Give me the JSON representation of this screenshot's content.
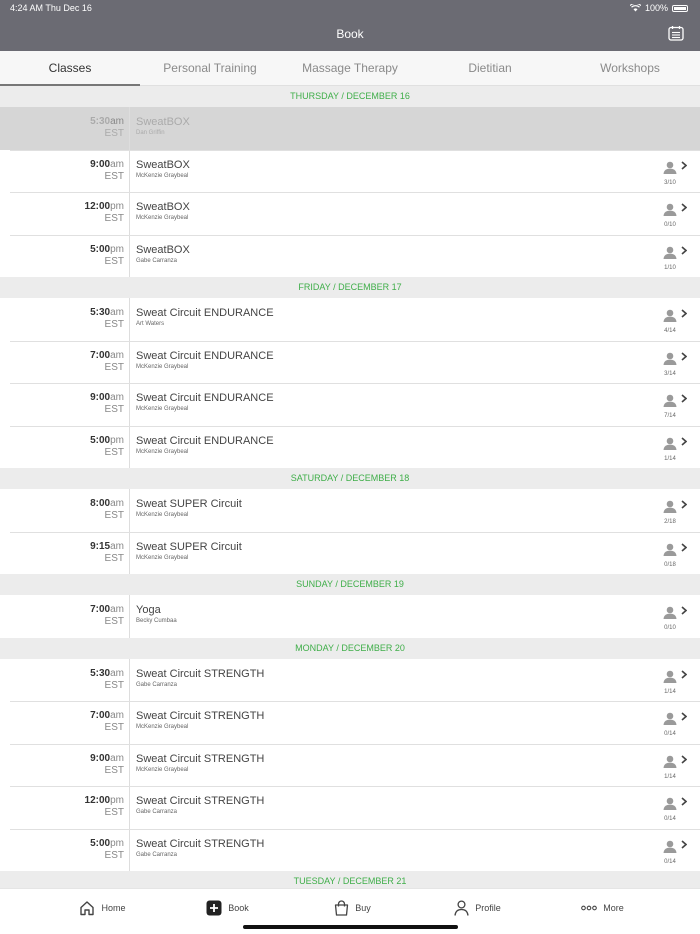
{
  "status": {
    "time": "4:24 AM  Thu Dec 16",
    "battery": "100%"
  },
  "header": {
    "title": "Book"
  },
  "tabs": [
    "Classes",
    "Personal Training",
    "Massage Therapy",
    "Dietitian",
    "Workshops"
  ],
  "days": [
    {
      "label": "THURSDAY / DECEMBER 16",
      "classes": [
        {
          "time": "5:30",
          "ampm": "am",
          "tz": "EST",
          "name": "SweatBOX",
          "instructor": "Dan Griffin",
          "disabled": true,
          "count": ""
        },
        {
          "time": "9:00",
          "ampm": "am",
          "tz": "EST",
          "name": "SweatBOX",
          "instructor": "McKenzie Graybeal",
          "count": "3/10"
        },
        {
          "time": "12:00",
          "ampm": "pm",
          "tz": "EST",
          "name": "SweatBOX",
          "instructor": "McKenzie Graybeal",
          "count": "0/10"
        },
        {
          "time": "5:00",
          "ampm": "pm",
          "tz": "EST",
          "name": "SweatBOX",
          "instructor": "Gabe Carranza",
          "count": "1/10"
        }
      ]
    },
    {
      "label": "FRIDAY / DECEMBER 17",
      "classes": [
        {
          "time": "5:30",
          "ampm": "am",
          "tz": "EST",
          "name": "Sweat Circuit ENDURANCE",
          "instructor": "Art Waters",
          "count": "4/14"
        },
        {
          "time": "7:00",
          "ampm": "am",
          "tz": "EST",
          "name": "Sweat Circuit ENDURANCE",
          "instructor": "McKenzie Graybeal",
          "count": "3/14"
        },
        {
          "time": "9:00",
          "ampm": "am",
          "tz": "EST",
          "name": "Sweat Circuit ENDURANCE",
          "instructor": "McKenzie Graybeal",
          "count": "7/14"
        },
        {
          "time": "5:00",
          "ampm": "pm",
          "tz": "EST",
          "name": "Sweat Circuit ENDURANCE",
          "instructor": "McKenzie Graybeal",
          "count": "1/14"
        }
      ]
    },
    {
      "label": "SATURDAY / DECEMBER 18",
      "classes": [
        {
          "time": "8:00",
          "ampm": "am",
          "tz": "EST",
          "name": "Sweat SUPER Circuit",
          "instructor": "McKenzie Graybeal",
          "count": "2/18"
        },
        {
          "time": "9:15",
          "ampm": "am",
          "tz": "EST",
          "name": "Sweat SUPER Circuit",
          "instructor": "McKenzie Graybeal",
          "count": "0/18"
        }
      ]
    },
    {
      "label": "SUNDAY / DECEMBER 19",
      "classes": [
        {
          "time": "7:00",
          "ampm": "am",
          "tz": "EST",
          "name": "Yoga",
          "instructor": "Becky Cumbaa",
          "count": "0/10"
        }
      ]
    },
    {
      "label": "MONDAY / DECEMBER 20",
      "classes": [
        {
          "time": "5:30",
          "ampm": "am",
          "tz": "EST",
          "name": "Sweat Circuit STRENGTH",
          "instructor": "Gabe Carranza",
          "count": "1/14"
        },
        {
          "time": "7:00",
          "ampm": "am",
          "tz": "EST",
          "name": "Sweat Circuit STRENGTH",
          "instructor": "McKenzie Graybeal",
          "count": "0/14"
        },
        {
          "time": "9:00",
          "ampm": "am",
          "tz": "EST",
          "name": "Sweat Circuit STRENGTH",
          "instructor": "McKenzie Graybeal",
          "count": "1/14"
        },
        {
          "time": "12:00",
          "ampm": "pm",
          "tz": "EST",
          "name": "Sweat Circuit STRENGTH",
          "instructor": "Gabe Carranza",
          "count": "0/14"
        },
        {
          "time": "5:00",
          "ampm": "pm",
          "tz": "EST",
          "name": "Sweat Circuit STRENGTH",
          "instructor": "Gabe Carranza",
          "count": "0/14"
        }
      ]
    },
    {
      "label": "TUESDAY / DECEMBER 21",
      "classes": []
    }
  ],
  "bottom_nav": [
    {
      "label": "Home",
      "icon": "home-icon"
    },
    {
      "label": "Book",
      "icon": "book-plus-icon"
    },
    {
      "label": "Buy",
      "icon": "shopping-bag-icon"
    },
    {
      "label": "Profile",
      "icon": "person-icon"
    },
    {
      "label": "More",
      "icon": "more-dots-icon"
    }
  ],
  "colors": {
    "header": "#6b6b73",
    "day_label": "#3fae49"
  }
}
